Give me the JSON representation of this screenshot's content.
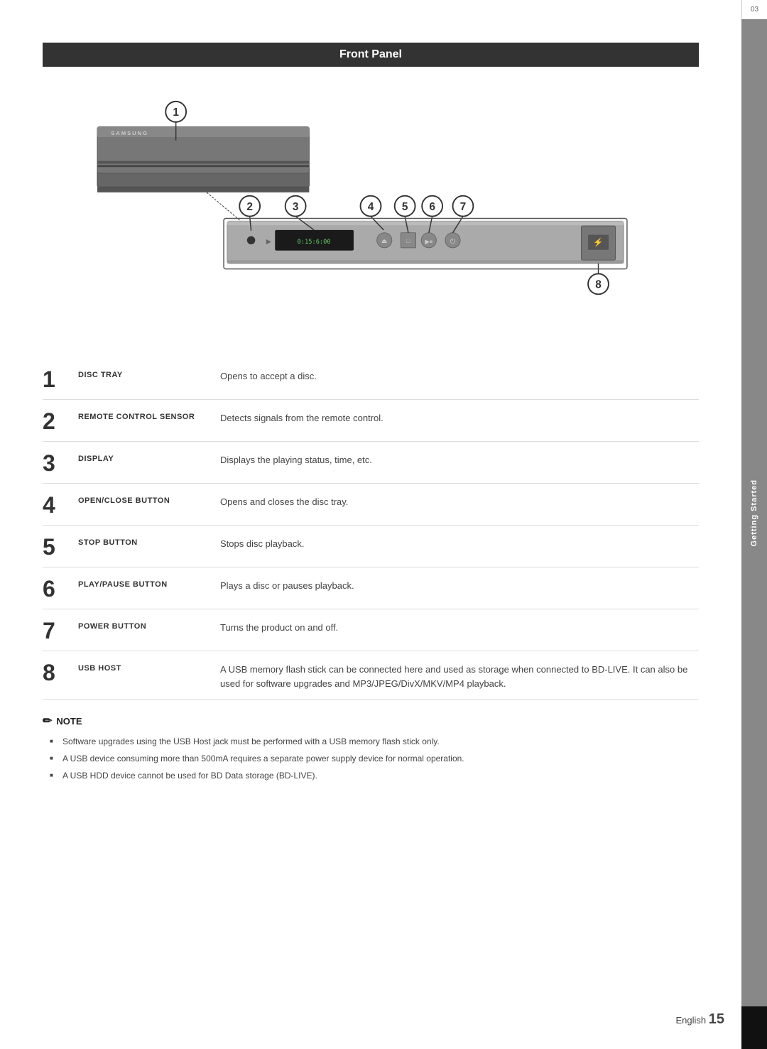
{
  "page": {
    "title": "Front Panel",
    "chapter_num": "03",
    "chapter_title": "Getting Started",
    "page_number": "15",
    "page_label": "English"
  },
  "diagram": {
    "callouts": [
      {
        "id": "1",
        "label": "1"
      },
      {
        "id": "2",
        "label": "2"
      },
      {
        "id": "3",
        "label": "3"
      },
      {
        "id": "4",
        "label": "4"
      },
      {
        "id": "5",
        "label": "5"
      },
      {
        "id": "6",
        "label": "6"
      },
      {
        "id": "7",
        "label": "7"
      },
      {
        "id": "8",
        "label": "8"
      }
    ],
    "device": {
      "brand": "SAMSUNG"
    },
    "display_text": "0:15:6:00"
  },
  "items": [
    {
      "number": "1",
      "label": "DISC TRAY",
      "description": "Opens to accept a disc."
    },
    {
      "number": "2",
      "label": "REMOTE CONTROL SENSOR",
      "description": "Detects signals from the remote control."
    },
    {
      "number": "3",
      "label": "DISPLAY",
      "description": "Displays the playing status, time, etc."
    },
    {
      "number": "4",
      "label": "OPEN/CLOSE BUTTON",
      "description": "Opens and closes the disc tray."
    },
    {
      "number": "5",
      "label": "STOP BUTTON",
      "description": "Stops disc playback."
    },
    {
      "number": "6",
      "label": "PLAY/PAUSE BUTTON",
      "description": "Plays a disc or pauses playback."
    },
    {
      "number": "7",
      "label": "POWER BUTTON",
      "description": "Turns the product on and off."
    },
    {
      "number": "8",
      "label": "USB HOST",
      "description": "A USB memory flash stick can be connected here and used as storage when connected to BD-LIVE. It can also be used for software upgrades and MP3/JPEG/DivX/MKV/MP4 playback."
    }
  ],
  "note": {
    "title": "NOTE",
    "items": [
      "Software upgrades using the USB Host jack must be performed with a USB memory flash stick only.",
      "A USB device consuming more than 500mA requires a separate power supply device for normal operation.",
      "A USB HDD device cannot be used for BD Data storage (BD-LIVE)."
    ]
  }
}
